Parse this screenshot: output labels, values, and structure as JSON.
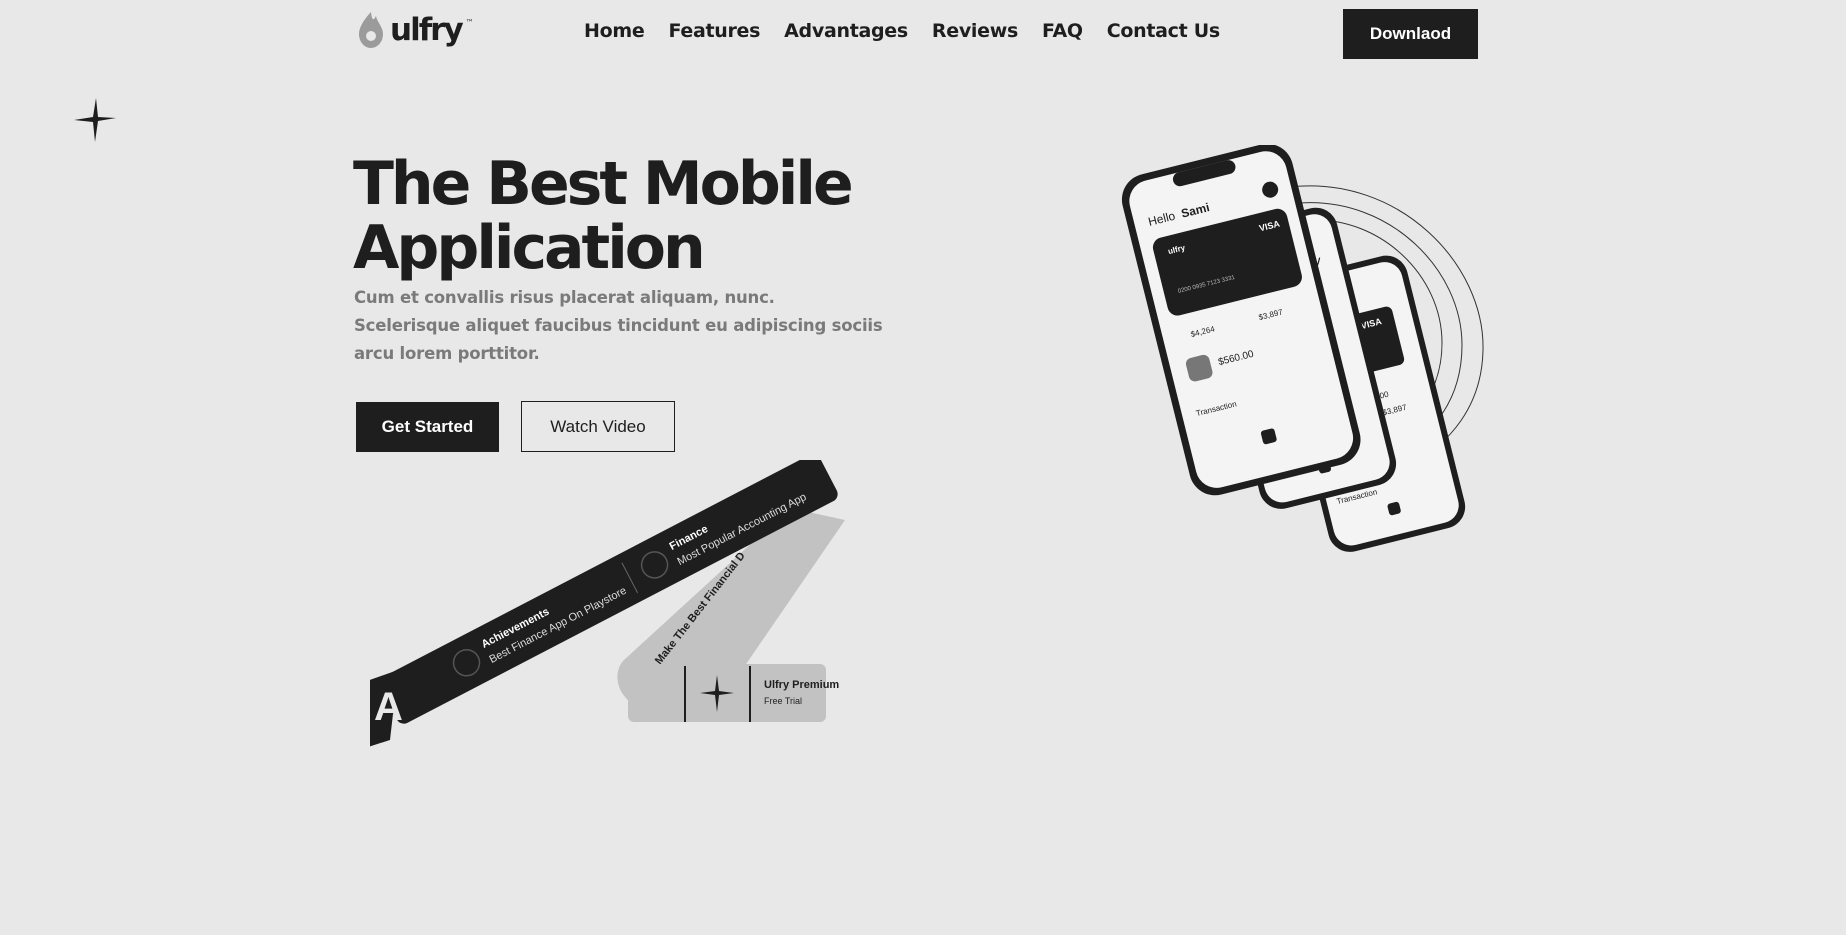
{
  "brand": {
    "name": "ulfry",
    "tm": "™"
  },
  "nav": {
    "items": [
      "Home",
      "Features",
      "Advantages",
      "Reviews",
      "FAQ",
      "Contact Us"
    ],
    "download_label": "Downlaod"
  },
  "hero": {
    "title_line1": "The Best Mobile",
    "title_line2": "Application",
    "subtitle": "Cum et convallis risus placerat aliquam, nunc. Scelerisque aliquet faucibus tincidunt eu adipiscing sociis arcu lorem porttitor.",
    "primary_button": "Get Started",
    "secondary_button": "Watch Video"
  },
  "ribbon": {
    "achievements_title": "Achievements",
    "achievements_text": "Best Finance App On Playstore",
    "finance_title": "Finance",
    "finance_text": "Most Popular Accounting App",
    "fold_text": "Make The Best Financial D",
    "letter": "A"
  },
  "premium_card": {
    "title": "Ulfry Premium",
    "subtitle": "Free Trial"
  },
  "phone_front": {
    "greeting": "Hello",
    "name": "Sami",
    "card_brand": "ulfry",
    "card_network": "VISA",
    "card_number": "0200 0935 7123 3331",
    "stat_up": "$4,264",
    "stat_down": "$3,897",
    "balance": "$560.00",
    "section": "Transaction"
  },
  "phone_middle": {
    "label": "$1000",
    "stat": "$3,897",
    "card_network": "VISA"
  },
  "phone_back": {
    "section": "Transaction"
  },
  "colors": {
    "background": "#e8e8e8",
    "ink": "#1e1e1e",
    "muted": "#7a7a7a",
    "ribbon_fold": "#c2c2c2"
  }
}
